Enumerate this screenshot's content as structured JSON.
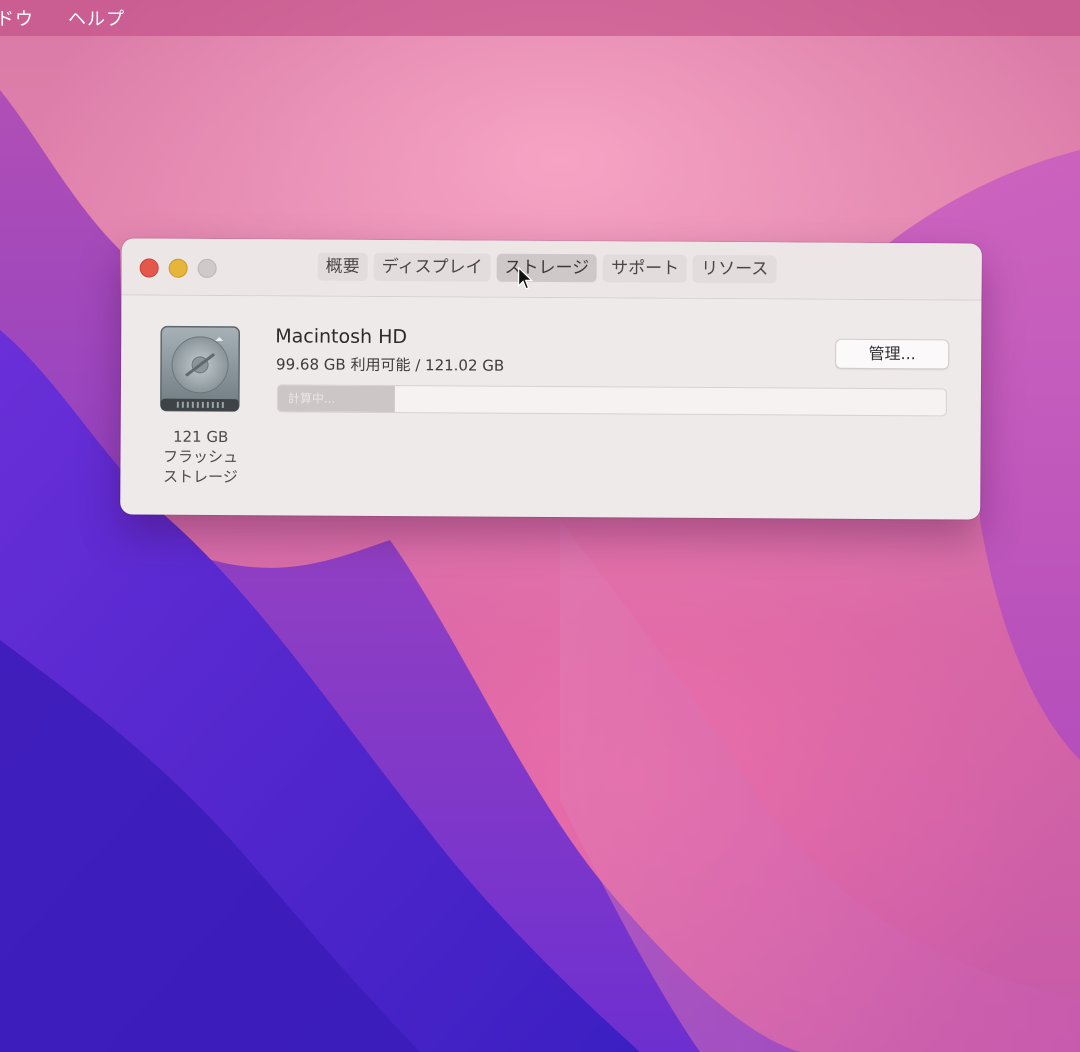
{
  "menubar": {
    "items": [
      "ドウ",
      "ヘルプ"
    ]
  },
  "window": {
    "tabs": [
      "概要",
      "ディスプレイ",
      "ストレージ",
      "サポート",
      "リソース"
    ],
    "active_tab": "ストレージ"
  },
  "storage": {
    "volume_name": "Macintosh HD",
    "capacity_text": "99.68 GB 利用可能 / 121.02 GB",
    "manage_label": "管理...",
    "status_text": "計算中...",
    "bar_fill_fraction": 0.175,
    "disk": {
      "size": "121 GB",
      "type_line1": "フラッシュ",
      "type_line2": "ストレージ",
      "icon": "internal-drive-icon"
    }
  },
  "colors": {
    "close": "#e5574c",
    "minimize": "#e6b63a",
    "zoom_disabled": "#cfcaca",
    "window_bg": "#efeaea"
  }
}
